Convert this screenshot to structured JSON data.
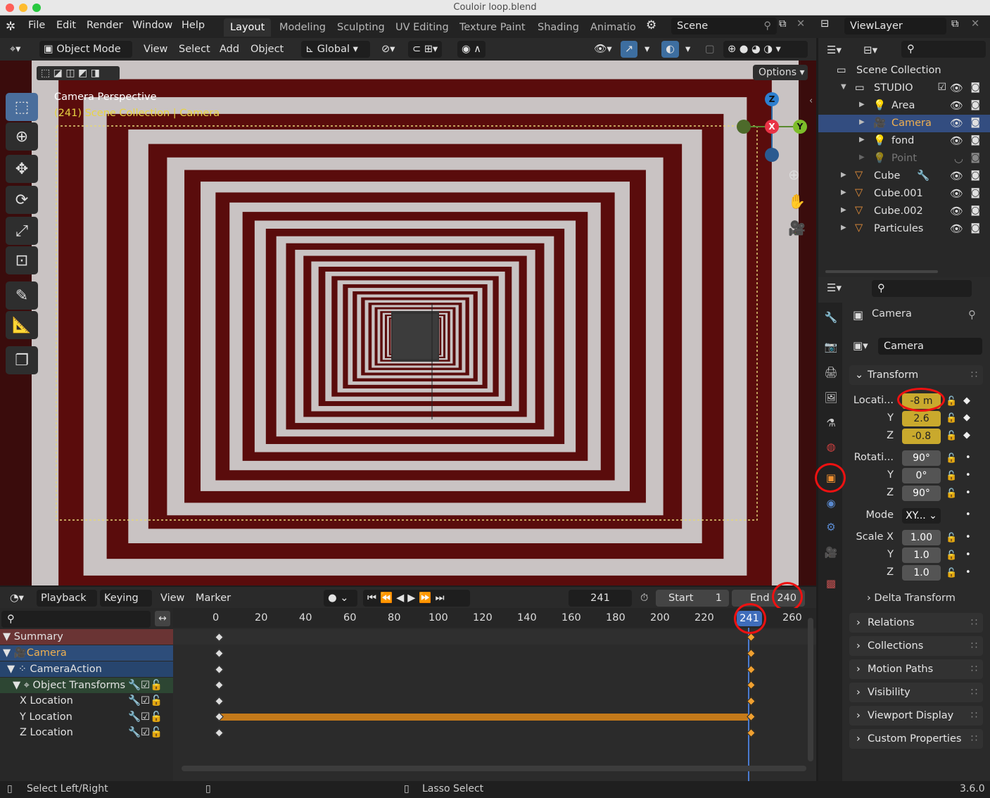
{
  "window": {
    "title": "Couloir loop.blend"
  },
  "menus": [
    "File",
    "Edit",
    "Render",
    "Window",
    "Help"
  ],
  "workspaces": [
    "Layout",
    "Modeling",
    "Sculpting",
    "UV Editing",
    "Texture Paint",
    "Shading",
    "Animation"
  ],
  "scene": {
    "name": "Scene"
  },
  "viewlayer": {
    "name": "ViewLayer"
  },
  "header": {
    "mode": "Object Mode",
    "view": "View",
    "select": "Select",
    "add": "Add",
    "object": "Object",
    "orientation": "Global",
    "options": "Options"
  },
  "viewport": {
    "line1": "Camera Perspective",
    "line2": "(241) Scene Collection | Camera",
    "gizmo": {
      "z": "Z",
      "x": "X",
      "y": "Y"
    }
  },
  "outliner": {
    "root": "Scene Collection",
    "rows": [
      {
        "label": "STUDIO"
      },
      {
        "label": "Area"
      },
      {
        "label": "Camera"
      },
      {
        "label": "fond"
      },
      {
        "label": "Point"
      },
      {
        "label": "Cube"
      },
      {
        "label": "Cube.001"
      },
      {
        "label": "Cube.002"
      },
      {
        "label": "Particules"
      }
    ]
  },
  "properties": {
    "object_name": "Camera",
    "data_name": "Camera",
    "transform": "Transform",
    "location_label": "Locati...",
    "location": {
      "x": "-8 m",
      "y": "2.6",
      "z": "-0.8"
    },
    "rotation_label": "Rotati...",
    "rotation": {
      "x": "90°",
      "y": "0°",
      "z": "90°"
    },
    "mode_label": "Mode",
    "mode_value": "XY...",
    "scale_label": "Scale X",
    "scale": {
      "x": "1.00",
      "y": "1.0",
      "z": "1.0"
    },
    "axis": {
      "y": "Y",
      "z": "Z"
    },
    "delta": "Delta Transform",
    "sections": [
      "Relations",
      "Collections",
      "Motion Paths",
      "Visibility",
      "Viewport Display",
      "Custom Properties"
    ]
  },
  "timeline": {
    "playback": "Playback",
    "keying": "Keying",
    "view": "View",
    "marker": "Marker",
    "current": "241",
    "start_label": "Start",
    "start": "1",
    "end_label": "End",
    "end": "240",
    "ticks": [
      "0",
      "20",
      "40",
      "60",
      "80",
      "100",
      "120",
      "140",
      "160",
      "180",
      "200",
      "220",
      "241",
      "260"
    ],
    "channels": [
      "Summary",
      "Camera",
      "CameraAction",
      "Object Transforms",
      "X Location",
      "Y Location",
      "Z Location"
    ]
  },
  "status": {
    "left": "Select Left/Right",
    "middle": "Lasso Select",
    "version": "3.6.0"
  }
}
